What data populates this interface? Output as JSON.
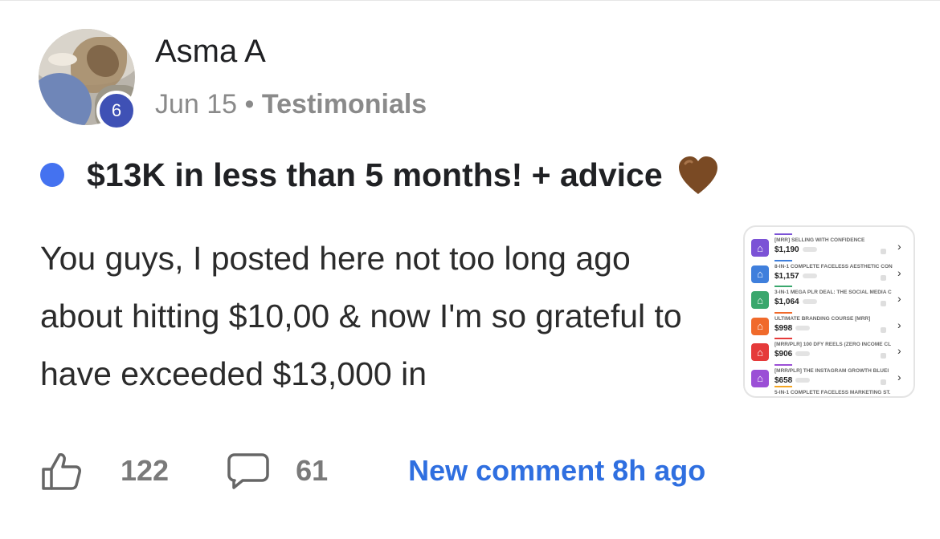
{
  "post": {
    "author": "Asma A",
    "level": "6",
    "date": "Jun 15",
    "separator": "•",
    "category": "Testimonials",
    "title": "$13K in less than 5 months! + advice",
    "title_emoji": "brown-heart-icon",
    "body": "You guys, I posted here not too long ago about hitting $10,00 & now I'm so grateful to have exceeded $13,000 in",
    "likes": "122",
    "comments": "61",
    "last_activity": "New comment 8h ago"
  },
  "thumbnail": {
    "rows": [
      {
        "name": "[MRR] SELLING WITH CONFIDENCE",
        "amount": "$1,190",
        "color": "#7b52d6"
      },
      {
        "name": "8-IN-1 COMPLETE FACELESS AESTHETIC CON",
        "amount": "$1,157",
        "color": "#3f7fdc"
      },
      {
        "name": "3-IN-1 MEGA PLR DEAL: THE SOCIAL MEDIA C",
        "amount": "$1,064",
        "color": "#3aa76d"
      },
      {
        "name": "ULTIMATE BRANDING COURSE [MRR]",
        "amount": "$998",
        "color": "#f06a2b"
      },
      {
        "name": "[MRR/PLR] 100 DFY REELS (ZERO INCOME CL",
        "amount": "$906",
        "color": "#e53a3a"
      },
      {
        "name": "[MRR/PLR] THE INSTAGRAM GROWTH BLUEI",
        "amount": "$658",
        "color": "#9b4fd6"
      }
    ],
    "last_row_name": "5-IN-1 COMPLETE FACELESS MARKETING ST.",
    "chevron": "›"
  },
  "colors": {
    "accent": "#2f6fe0",
    "unread_dot": "#4472f0",
    "level_badge": "#3f51b5"
  }
}
